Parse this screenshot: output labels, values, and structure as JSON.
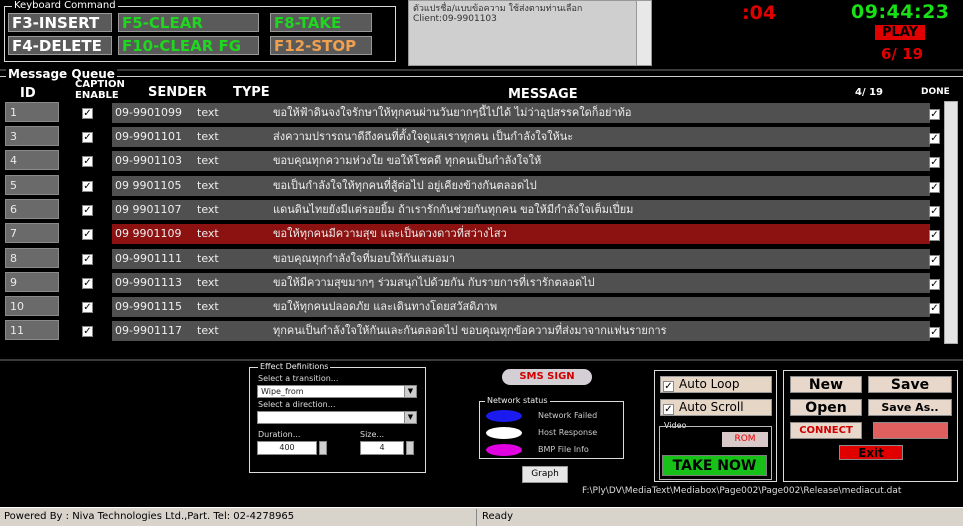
{
  "keyboard": {
    "legend": "Keyboard Command",
    "buttons": [
      {
        "label": "F3-INSERT",
        "color": "#ffffff"
      },
      {
        "label": "F5-CLEAR",
        "color": "#1ed71e"
      },
      {
        "label": "F8-TAKE",
        "color": "#1ed71e"
      },
      {
        "label": "F4-DELETE",
        "color": "#ffffff"
      },
      {
        "label": "F10-CLEAR FG",
        "color": "#1ed71e"
      },
      {
        "label": "F12-STOP",
        "color": "#f0a050"
      }
    ]
  },
  "log": {
    "line1": "ตัวแปรชื่อ/แบบข้อความ ใช้ส่งตามท่านเลือก",
    "line2": "Client:09-9901103"
  },
  "status": {
    "countdown": ":04",
    "clock": "09:44:23",
    "play": "PLAY",
    "pager": "6/ 19"
  },
  "queue": {
    "legend": "Message Queue",
    "col_id": "ID",
    "col_caption": "CAPTION",
    "col_enable": "ENABLE",
    "col_sender": "SENDER",
    "col_type": "TYPE",
    "col_message": "MESSAGE",
    "page_count": "4/ 19",
    "col_done": "DONE",
    "rows": [
      {
        "id": "1",
        "sender": "09-9901099",
        "type": "text",
        "message": "ขอให้ฟ้าดินจงใจรักษาให้ทุกคนผ่านวันยากๆนี้ไปได้ ไม่ว่าอุปสรรคใดก็อย่าท้อ"
      },
      {
        "id": "3",
        "sender": "09-9901101",
        "type": "text",
        "message": "ส่งความปรารถนาดีถึงคนที่ตั้งใจดูแลเราทุกคน เป็นกำลังใจให้นะ"
      },
      {
        "id": "4",
        "sender": "09-9901103",
        "type": "text",
        "message": "ขอบคุณทุกความห่วงใย ขอให้โชคดี ทุกคนเป็นกำลังใจให้"
      },
      {
        "id": "5",
        "sender": "09 9901105",
        "type": "text",
        "message": "ขอเป็นกำลังใจให้ทุกคนที่สู้ต่อไป อยู่เคียงข้างกันตลอดไป"
      },
      {
        "id": "6",
        "sender": "09 9901107",
        "type": "text",
        "message": "แดนดินไทยยังมีแต่รอยยิ้ม ถ้าเรารักกันช่วยกันทุกคน ขอให้มีกำลังใจเต็มเปี่ยม"
      },
      {
        "id": "7",
        "sender": "09 9901109",
        "type": "text",
        "message": "ขอให้ทุกคนมีความสุข และเป็นดวงดาวที่สว่างไสว"
      },
      {
        "id": "8",
        "sender": "09-9901111",
        "type": "text",
        "message": "ขอบคุณทุกกำลังใจที่มอบให้กันเสมอมา"
      },
      {
        "id": "9",
        "sender": "09-9901113",
        "type": "text",
        "message": "ขอให้มีความสุขมากๆ ร่วมสนุกไปด้วยกัน กับรายการที่เรารักตลอดไป"
      },
      {
        "id": "10",
        "sender": "09-9901115",
        "type": "text",
        "message": "ขอให้ทุกคนปลอดภัย และเดินทางโดยสวัสดิภาพ"
      },
      {
        "id": "11",
        "sender": "09-9901117",
        "type": "text",
        "message": "ทุกคนเป็นกำลังใจให้กันและกันตลอดไป ขอบคุณทุกข้อความที่ส่งมาจากแฟนรายการ"
      }
    ]
  },
  "effects": {
    "legend": "Effect Definitions",
    "transition_label": "Select a transition...",
    "transition_value": "Wipe_from",
    "direction_label": "Select a direction...",
    "direction_value": "",
    "duration_label": "Duration...",
    "duration_value": "400",
    "size_label": "Size...",
    "size_value": "4"
  },
  "sms_sign": "SMS SIGN",
  "network": {
    "legend": "Network status",
    "items": [
      {
        "label": "Network Failed",
        "color": "#1b1bf0"
      },
      {
        "label": "Host Response",
        "color": "#ffffff"
      },
      {
        "label": "BMP File Info",
        "color": "#e000e0"
      }
    ]
  },
  "graph_button": "Graph",
  "options": {
    "auto_loop": "Auto Loop",
    "auto_scroll": "Auto Scroll",
    "video_legend": "Video",
    "rom": "ROM",
    "take_now": "TAKE NOW"
  },
  "controls": {
    "new": "New",
    "save": "Save",
    "open": "Open",
    "save_as": "Save As..",
    "connect": "CONNECT",
    "disconnect": "",
    "exit": "Exit"
  },
  "path": "F:\\Ply\\DV\\MediaText\\Mediabox\\Page002\\Page002\\Release\\mediacut.dat",
  "statusbar": {
    "left": "Powered By : Niva Technologies Ltd.,Part. Tel: 02-4278965",
    "right": "Ready"
  }
}
